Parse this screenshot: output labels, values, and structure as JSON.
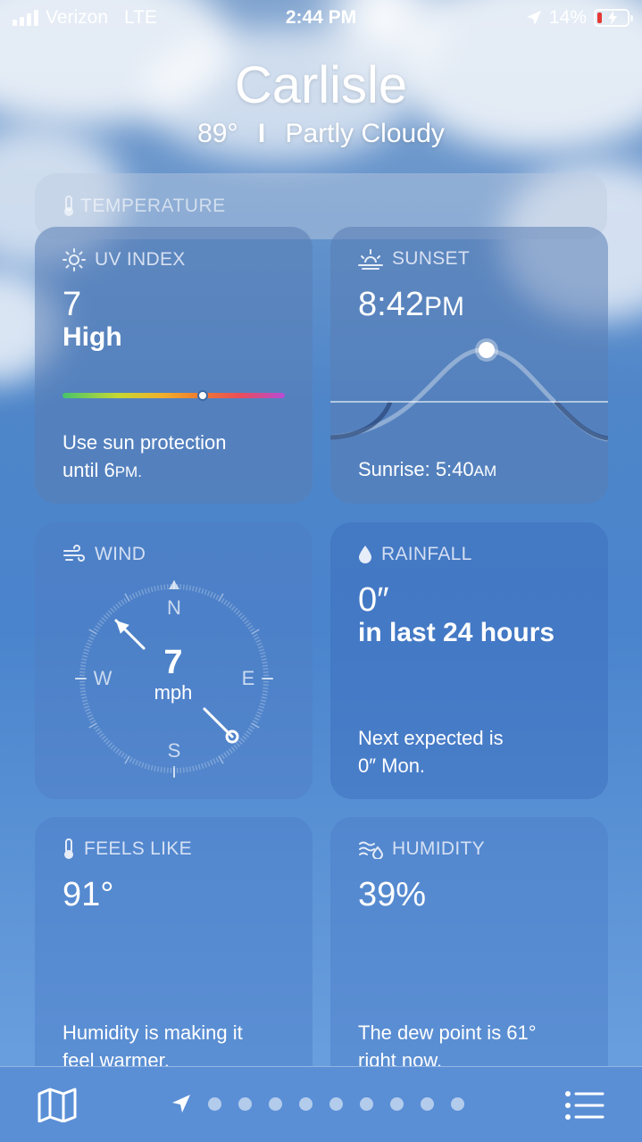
{
  "status_bar": {
    "carrier": "Verizon",
    "network": "LTE",
    "time": "2:44 PM",
    "battery": "14%"
  },
  "header": {
    "city": "Carlisle",
    "temperature": "89°",
    "separator": "I",
    "condition": "Partly Cloudy"
  },
  "temperature_card": {
    "label": "TEMPERATURE"
  },
  "uv_card": {
    "label": "UV INDEX",
    "value": "7",
    "level": "High",
    "level_position": 0.63,
    "desc_line1": "Use sun protection",
    "desc_line2_prefix": "until 6",
    "desc_line2_suffix": "PM."
  },
  "sunset_card": {
    "label": "SUNSET",
    "time": "8:42",
    "time_suffix": "PM",
    "sunrise_prefix": "Sunrise: 5:40",
    "sunrise_suffix": "AM"
  },
  "wind_card": {
    "label": "WIND",
    "speed": "7",
    "unit": "mph",
    "compass": {
      "n": "N",
      "e": "E",
      "s": "S",
      "w": "W"
    },
    "direction_deg": 315
  },
  "rainfall_card": {
    "label": "RAINFALL",
    "value": "0″",
    "period": "in last 24 hours",
    "desc_line1": "Next expected is",
    "desc_line2": "0″ Mon."
  },
  "feels_like_card": {
    "label": "FEELS LIKE",
    "value": "91°",
    "desc_line1": "Humidity is making it",
    "desc_line2": "feel warmer."
  },
  "humidity_card": {
    "label": "HUMIDITY",
    "value": "39%",
    "desc_line1": "The dew point is 61°",
    "desc_line2": "right now."
  },
  "bottom_bar": {
    "page_count": 9,
    "current_page": 0
  },
  "colors": {
    "accent_text": "#e6edf8",
    "battery_low": "#e53935"
  }
}
